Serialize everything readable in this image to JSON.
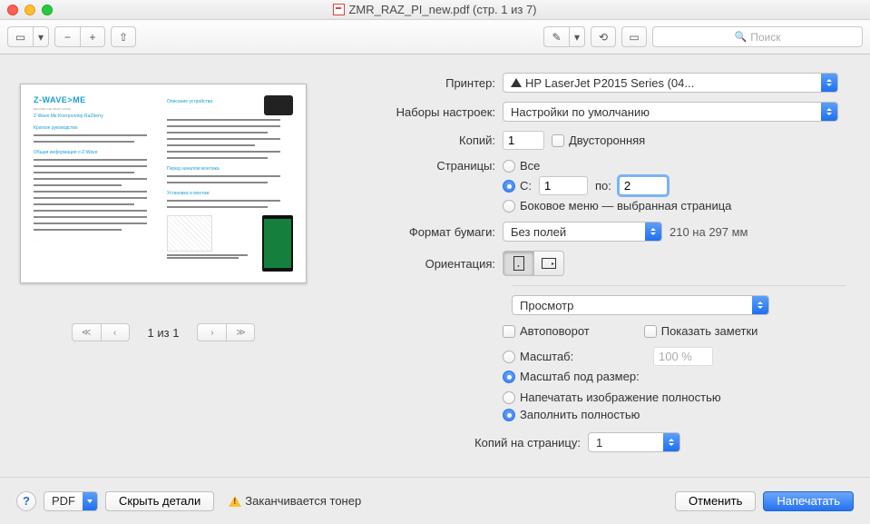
{
  "titlebar": {
    "title": "ZMR_RAZ_PI_new.pdf (стр. 1 из 7)"
  },
  "toolbar": {
    "search_placeholder": "Поиск"
  },
  "preview": {
    "logo": "Z-WAVE>ME",
    "tagline": "BECOME THE SMART HOME",
    "heading": "Z-Wave.Me Контроллер RaZberry",
    "sect1": "Краткое руководство",
    "sect2": "Общая информация о Z-Wave",
    "sect3": "Описание устройства",
    "sect4": "Перед началом монтажа",
    "sect5": "Установка и монтаж"
  },
  "pager": {
    "label": "1 из 1"
  },
  "form": {
    "printer_label": "Принтер:",
    "printer_value": "HP LaserJet P2015 Series (04...",
    "presets_label": "Наборы настроек:",
    "presets_value": "Настройки по умолчанию",
    "copies_label": "Копий:",
    "copies_value": "1",
    "duplex_label": "Двусторонняя",
    "pages_label": "Страницы:",
    "pages_all": "Все",
    "pages_from": "С:",
    "pages_from_val": "1",
    "pages_to": "по:",
    "pages_to_val": "2",
    "pages_side": "Боковое меню — выбранная страница",
    "paper_label": "Формат бумаги:",
    "paper_value": "Без полей",
    "paper_hint": "210 на 297 мм",
    "orientation_label": "Ориентация:",
    "section_select": "Просмотр",
    "autorotate": "Автоповорот",
    "show_notes": "Показать заметки",
    "scale_label": "Масштаб:",
    "scale_value": "100 %",
    "scale_fit_label": "Масштаб под размер:",
    "fit_full": "Напечатать изображение полностью",
    "fit_fill": "Заполнить полностью",
    "copies_per_page_label": "Копий на страницу:",
    "copies_per_page_value": "1"
  },
  "footer": {
    "help": "?",
    "pdf": "PDF",
    "hide_details": "Скрыть детали",
    "toner": "Заканчивается тонер",
    "cancel": "Отменить",
    "print": "Напечатать"
  }
}
